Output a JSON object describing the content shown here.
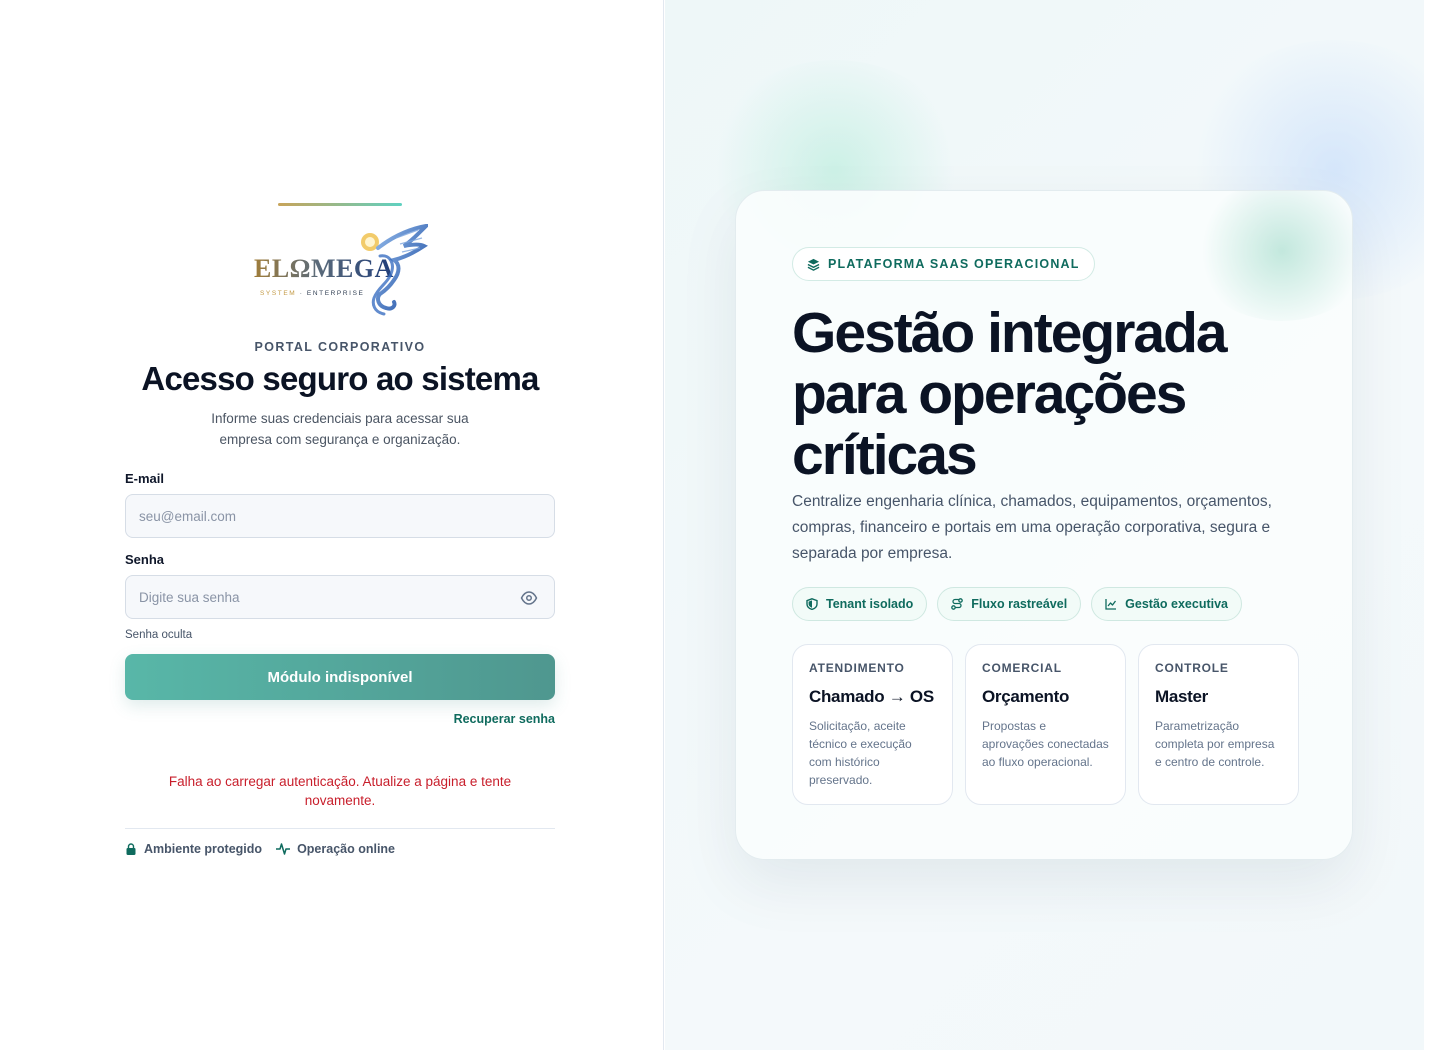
{
  "login": {
    "logo_text": "ELΩMEGA",
    "logo_sub_gold": "SYSTEM",
    "logo_sub_rest": "· ENTERPRISE",
    "portal_label": "PORTAL CORPORATIVO",
    "title": "Acesso seguro ao sistema",
    "subtitle": "Informe suas credenciais para acessar sua empresa com segurança e organização.",
    "email_label": "E-mail",
    "email_placeholder": "seu@email.com",
    "password_label": "Senha",
    "password_placeholder": "Digite sua senha",
    "password_hint": "Senha oculta",
    "submit_label": "Módulo indisponível",
    "recover_label": "Recuperar senha",
    "error_message": "Falha ao carregar autenticação. Atualize a página e tente novamente.",
    "footer": {
      "protected": "Ambiente protegido",
      "online": "Operação online"
    }
  },
  "hero": {
    "badge": "PLATAFORMA SAAS OPERACIONAL",
    "headline": "Gestão integrada para operações críticas",
    "description": "Centralize engenharia clínica, chamados, equipamentos, orçamentos, compras, financeiro e portais em uma operação corporativa, segura e separada por empresa.",
    "chips": [
      {
        "label": "Tenant isolado",
        "icon": "shield-icon"
      },
      {
        "label": "Fluxo rastreável",
        "icon": "route-icon"
      },
      {
        "label": "Gestão executiva",
        "icon": "chart-line-icon"
      }
    ],
    "tiles": [
      {
        "label": "ATENDIMENTO",
        "title": "Chamado → OS",
        "text": "Solicitação, aceite técnico e execução com histórico preservado."
      },
      {
        "label": "COMERCIAL",
        "title": "Orçamento",
        "text": "Propostas e aprovações conectadas ao fluxo operacional."
      },
      {
        "label": "CONTROLE",
        "title": "Master",
        "text": "Parametrização completa por empresa e centro de controle."
      }
    ]
  },
  "colors": {
    "accent": "#0f6b5e",
    "button_start": "#58b7a8",
    "button_end": "#4f978f",
    "error": "#c81e2b"
  }
}
